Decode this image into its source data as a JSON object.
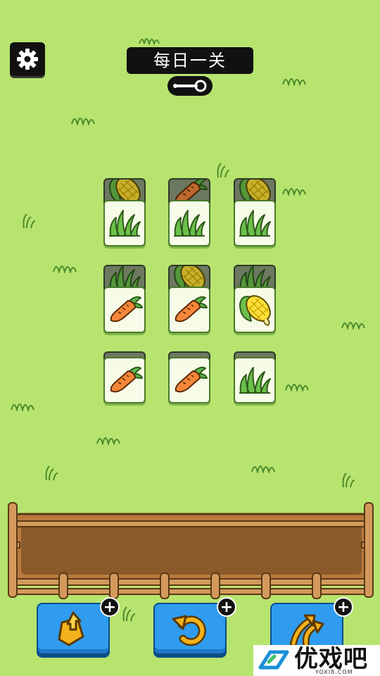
{
  "header": {
    "title": "每日一关"
  },
  "icons": {
    "settings": "gear-icon",
    "key": "key-icon"
  },
  "board": {
    "rows": [
      {
        "top": [
          "corn",
          "carrot",
          "corn"
        ],
        "front": [
          "grass",
          "grass",
          "grass"
        ]
      },
      {
        "top": [
          "grass",
          "corn",
          "grass"
        ],
        "front": [
          "carrot",
          "carrot",
          "corn"
        ]
      },
      {
        "top": [
          "",
          "",
          ""
        ],
        "front": [
          "carrot",
          "carrot",
          "grass"
        ]
      }
    ]
  },
  "toolbar": {
    "buttons": [
      {
        "name": "move-out-button",
        "icon": "move-out-icon",
        "badge": "+"
      },
      {
        "name": "undo-button",
        "icon": "undo-icon",
        "badge": "+"
      },
      {
        "name": "shuffle-button",
        "icon": "shuffle-icon",
        "badge": "+"
      }
    ]
  },
  "watermark": {
    "text": "优戏吧",
    "sub": "YOXI8.COM"
  },
  "colors": {
    "background": "#b7e46f",
    "button": "#2f9cf0",
    "fence": "#c8884a",
    "slot": "#8a5a2a"
  }
}
